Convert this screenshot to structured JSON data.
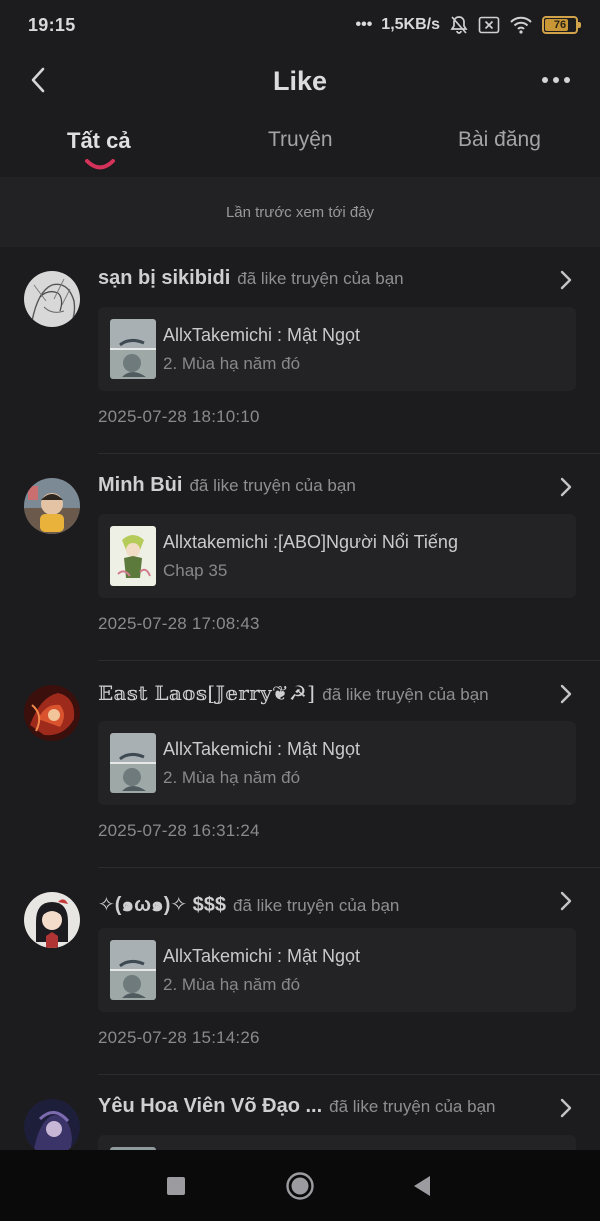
{
  "status": {
    "time": "19:15",
    "network_speed": "1,5KB/s",
    "battery_level": "76",
    "battery_fraction": 0.76
  },
  "header": {
    "title": "Like"
  },
  "tabs": [
    {
      "label": "Tất cả",
      "active": true
    },
    {
      "label": "Truyện",
      "active": false
    },
    {
      "label": "Bài đăng",
      "active": false
    }
  ],
  "last_viewed": "Lần trước xem tới đây",
  "feed": [
    {
      "user": "sạn bị sikibidi",
      "action": "đã like truyện của bạn",
      "story_title": "AllxTakemichi : Mật Ngọt",
      "story_subtitle": "2. Mùa hạ năm đó",
      "time": "2025-07-28 18:10:10"
    },
    {
      "user": "Minh Bùi",
      "action": "đã like truyện của bạn",
      "story_title": "Allxtakemichi :[ABO]Người Nổi Tiếng",
      "story_subtitle": "Chap 35",
      "time": "2025-07-28 17:08:43"
    },
    {
      "user": "𝔼𝕒𝕤𝕥 𝕃𝕒𝕠𝕤[𝕁𝕖𝕣𝕣𝕪❦☭]",
      "action": "đã like truyện của bạn",
      "story_title": "AllxTakemichi : Mật Ngọt",
      "story_subtitle": "2. Mùa hạ năm đó",
      "time": "2025-07-28 16:31:24"
    },
    {
      "user": "✧(๑ω๑)✧ $$$",
      "action": "đã like truyện của bạn",
      "story_title": "AllxTakemichi : Mật Ngọt",
      "story_subtitle": "2. Mùa hạ năm đó",
      "time": "2025-07-28 15:14:26"
    },
    {
      "user": "Yêu Hoa Viên Võ Đạo ...",
      "action": "đã like truyện của bạn",
      "story_title": "",
      "story_subtitle": "",
      "time": ""
    }
  ],
  "colors": {
    "background": "#1c1c1e",
    "accent": "#d4325a",
    "battery": "#d0a24a"
  }
}
